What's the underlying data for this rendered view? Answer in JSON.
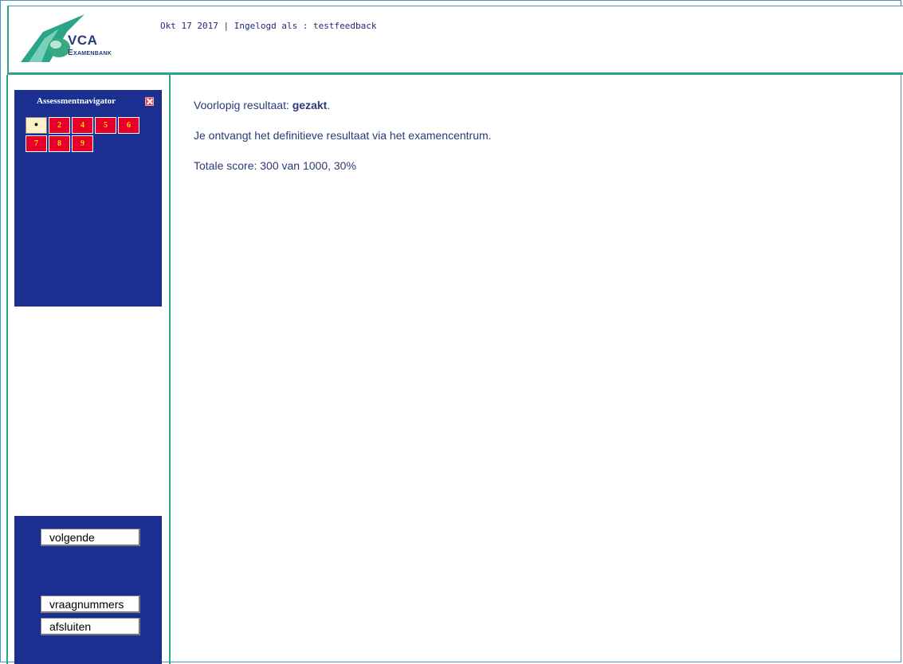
{
  "header": {
    "logo_main": "VCA",
    "logo_sub": "Examenbank",
    "info": "Okt 17 2017 | Ingelogd als : testfeedback"
  },
  "navigator": {
    "title": "Assessmentnavigator",
    "questions": [
      {
        "label": "•",
        "state": "current"
      },
      {
        "label": "2",
        "state": "wrong"
      },
      {
        "label": "4",
        "state": "wrong"
      },
      {
        "label": "5",
        "state": "wrong"
      },
      {
        "label": "6",
        "state": "wrong"
      },
      {
        "label": "7",
        "state": "wrong"
      },
      {
        "label": "8",
        "state": "wrong"
      },
      {
        "label": "9",
        "state": "wrong"
      }
    ]
  },
  "actions": {
    "next": "volgende",
    "question_numbers": "vraagnummers",
    "close": "afsluiten"
  },
  "result": {
    "label": "Voorlopig resultaat: ",
    "value": "gezakt",
    "period": ".",
    "message": "Je ontvangt het definitieve resultaat via het examencentrum.",
    "score": "Totale score: 300  van 1000, 30%"
  },
  "colors": {
    "navy": "#1a2f8f",
    "teal": "#2aa58a",
    "red": "#e8002a",
    "text": "#2a3a7a"
  }
}
